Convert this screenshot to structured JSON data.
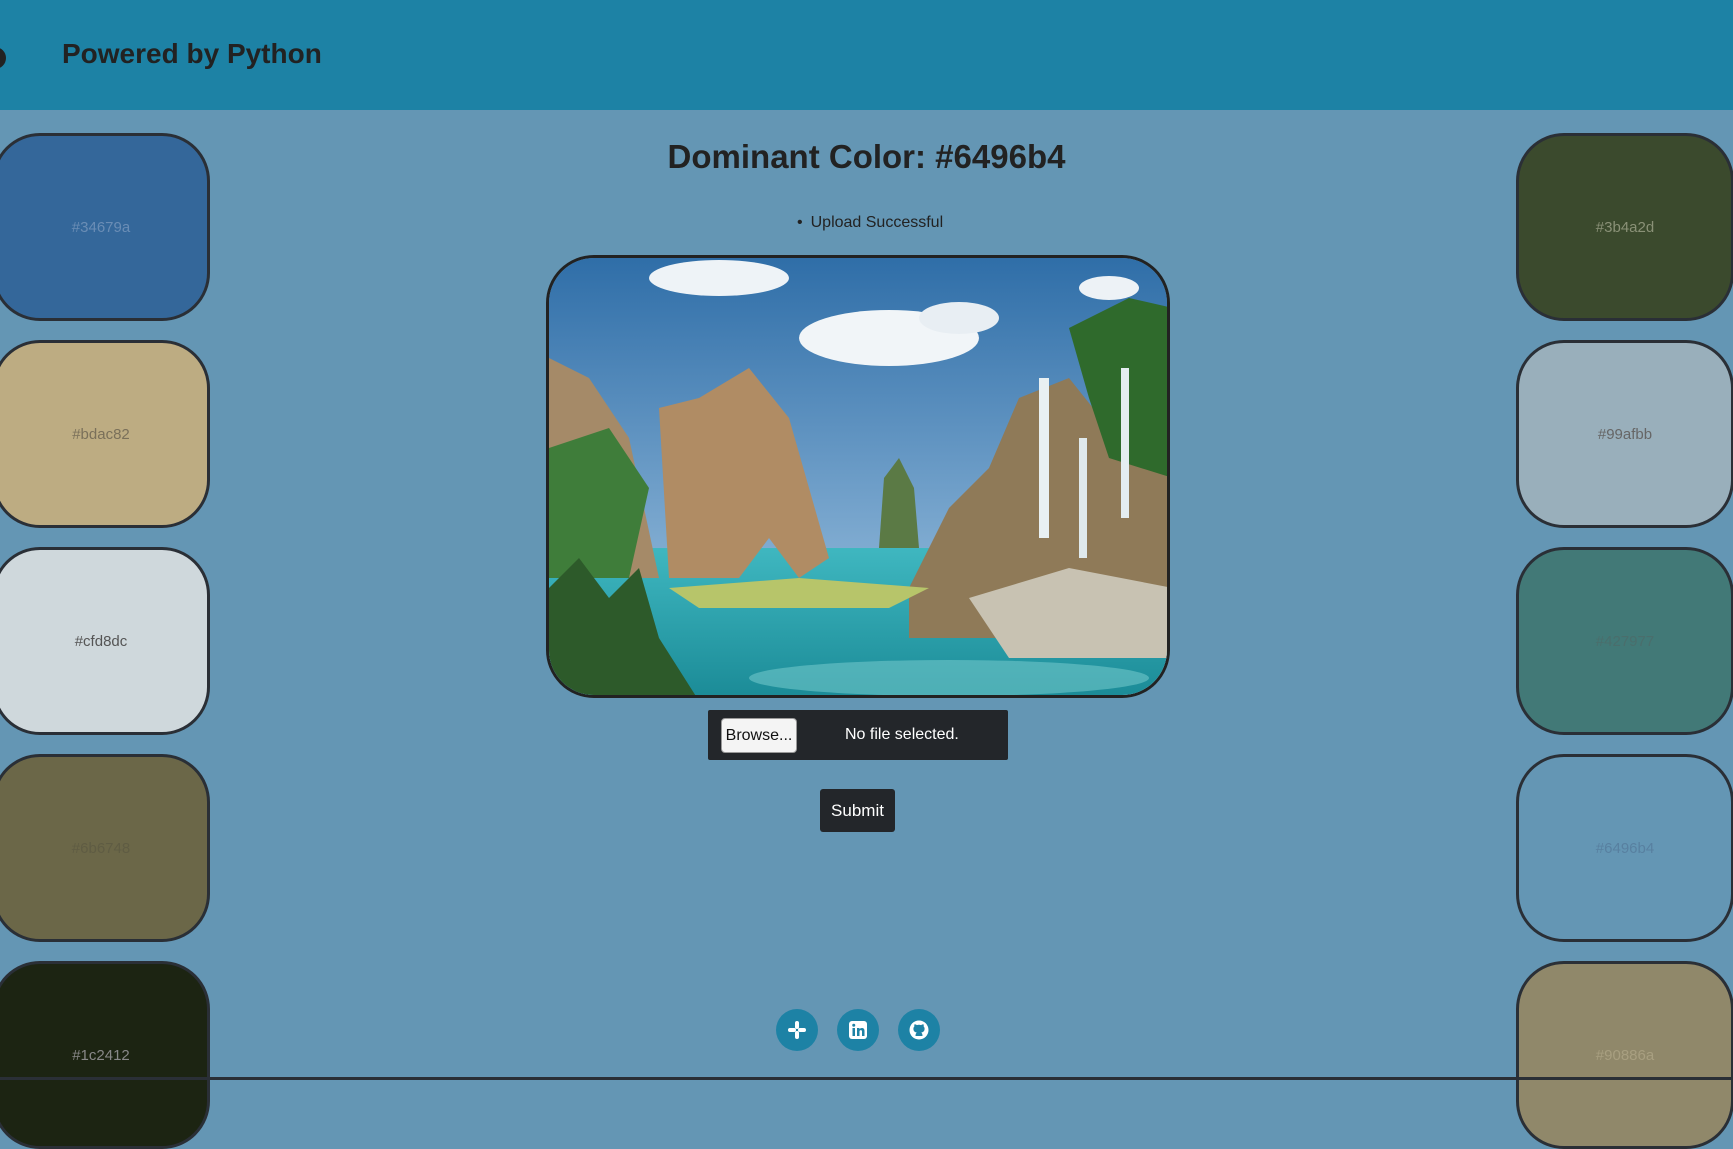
{
  "header": {
    "brand": "Powered by Python"
  },
  "title": "Dominant Color: #6496b4",
  "message": "Upload Successful",
  "form": {
    "browse_label": "Browse...",
    "file_status": "No file selected.",
    "submit_label": "Submit"
  },
  "palette_left": [
    {
      "hex": "#34679a",
      "label": "#34679a",
      "text_color": "#6a8db5"
    },
    {
      "hex": "#bdac82",
      "label": "#bdac82",
      "text_color": "#7a705a"
    },
    {
      "hex": "#cfd8dc",
      "label": "#cfd8dc",
      "text_color": "#555"
    },
    {
      "hex": "#6b6748",
      "label": "#6b6748",
      "text_color": "#5f5c43"
    },
    {
      "hex": "#1c2412",
      "label": "#1c2412",
      "text_color": "#888"
    }
  ],
  "palette_right": [
    {
      "hex": "#3b4a2d",
      "label": "#3b4a2d",
      "text_color": "#8a9177"
    },
    {
      "hex": "#99afbb",
      "label": "#99afbb",
      "text_color": "#666"
    },
    {
      "hex": "#427977",
      "label": "#427977",
      "text_color": "#4a6e6c"
    },
    {
      "hex": "#6496b4",
      "label": "#6496b4",
      "text_color": "#5880a0"
    },
    {
      "hex": "#90886a",
      "label": "#90886a",
      "text_color": "#a89f80"
    }
  ],
  "social": [
    {
      "name": "slack-icon"
    },
    {
      "name": "linkedin-icon"
    },
    {
      "name": "github-icon"
    }
  ]
}
